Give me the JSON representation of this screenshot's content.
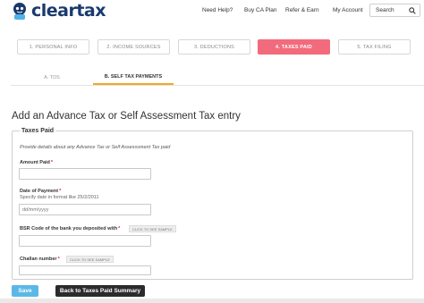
{
  "header": {
    "logo_text": "cleartax",
    "nav": [
      "Need Help?",
      "Buy CA Plan",
      "Refer & Earn",
      "My Account"
    ],
    "search_label": "Search"
  },
  "steps": [
    "1. PERSONAL INFO",
    "2. INCOME SOURCES",
    "3. DEDUCTIONS",
    "4. TAXES PAID",
    "5. TAX FILING"
  ],
  "active_step": "4. TAXES PAID",
  "subtabs": [
    "A. TDS",
    "B. SELF TAX PAYMENTS"
  ],
  "active_subtab": "B. SELF TAX PAYMENTS",
  "page_title": "Add an Advance Tax or Self Assessment Tax entry",
  "form": {
    "legend": "Taxes Paid",
    "description": "Provide details about any Advance Tax or Self Assesssment Tax paid",
    "amount_label": "Amount Paid",
    "date_label": "Date of Payment",
    "date_hint": "Specify date in format like 25/2/2011",
    "date_placeholder": "dd/mm/yyyy",
    "bsr_label": "BSR Code of the bank you deposited with",
    "challan_label": "Challan number",
    "sample_label": "CLICK TO SEE SAMPLE",
    "required_mark": "*"
  },
  "actions": {
    "save": "Save",
    "back": "Back to Taxes Paid Summary"
  },
  "colors": {
    "brand": "#1a3a6e",
    "active_step": "#f26b7c",
    "subtab_underline": "#f5a623",
    "save_button": "#5bb8e6",
    "back_button": "#2b2b2b"
  }
}
